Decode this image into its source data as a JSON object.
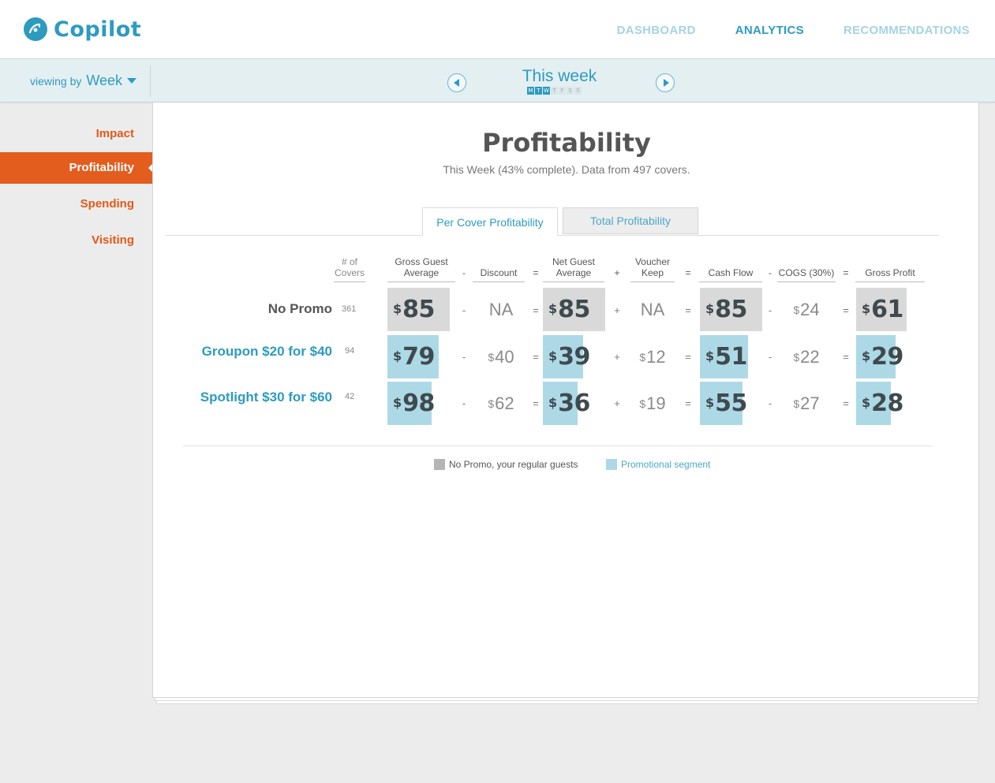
{
  "header": {
    "logo_text": "Copilot",
    "nav": [
      {
        "label": "DASHBOARD",
        "active": false
      },
      {
        "label": "ANALYTICS",
        "active": true
      },
      {
        "label": "RECOMMENDATIONS",
        "active": false
      }
    ]
  },
  "toolbar": {
    "viewing_label": "viewing by",
    "viewing_value": "Week",
    "period_title": "This week",
    "days": [
      "M",
      "T",
      "W",
      "T",
      "F",
      "S",
      "S"
    ]
  },
  "sidebar": {
    "items": [
      {
        "label": "Impact"
      },
      {
        "label": "Profitability"
      },
      {
        "label": "Spending"
      },
      {
        "label": "Visiting"
      }
    ]
  },
  "main": {
    "title": "Profitability",
    "subtitle": "This Week (43% complete).  Data from 497 covers.",
    "tabs": [
      {
        "label": "Per Cover Profitability"
      },
      {
        "label": "Total Profitability"
      }
    ],
    "columns": {
      "covers_1": "# of",
      "covers_2": "Covers",
      "gross_1": "Gross Guest",
      "gross_2": "Average",
      "discount": "Discount",
      "net_1": "Net Guest",
      "net_2": "Average",
      "voucher_1": "Voucher",
      "voucher_2": "Keep",
      "cashflow": "Cash Flow",
      "cogs": "COGS (30%)",
      "profit": "Gross Profit"
    },
    "operators": {
      "minus": "-",
      "equals": "=",
      "plus": "+"
    },
    "currency": "$",
    "rows": [
      {
        "label": "No Promo",
        "covers": "361",
        "gross": "85",
        "discount": "NA",
        "net": "85",
        "voucher": "NA",
        "cashflow": "85",
        "cogs": "24",
        "profit": "61"
      },
      {
        "label": "Groupon $20 for $40",
        "covers": "94",
        "gross": "79",
        "discount": "40",
        "net": "39",
        "voucher": "12",
        "cashflow": "51",
        "cogs": "22",
        "profit": "29"
      },
      {
        "label": "Spotlight $30 for $60",
        "covers": "42",
        "gross": "98",
        "discount": "62",
        "net": "36",
        "voucher": "19",
        "cashflow": "55",
        "cogs": "27",
        "profit": "28"
      }
    ],
    "legend": [
      {
        "label": "No Promo, your regular guests",
        "color": "#b5b5b5"
      },
      {
        "label": "Promotional segment",
        "color": "#add9e6"
      }
    ]
  },
  "colors": {
    "accent": "#2d9bbf",
    "orange": "#e35d1f",
    "grey_cell": "#d9d9d9",
    "blue_cell": "#add9e6"
  }
}
